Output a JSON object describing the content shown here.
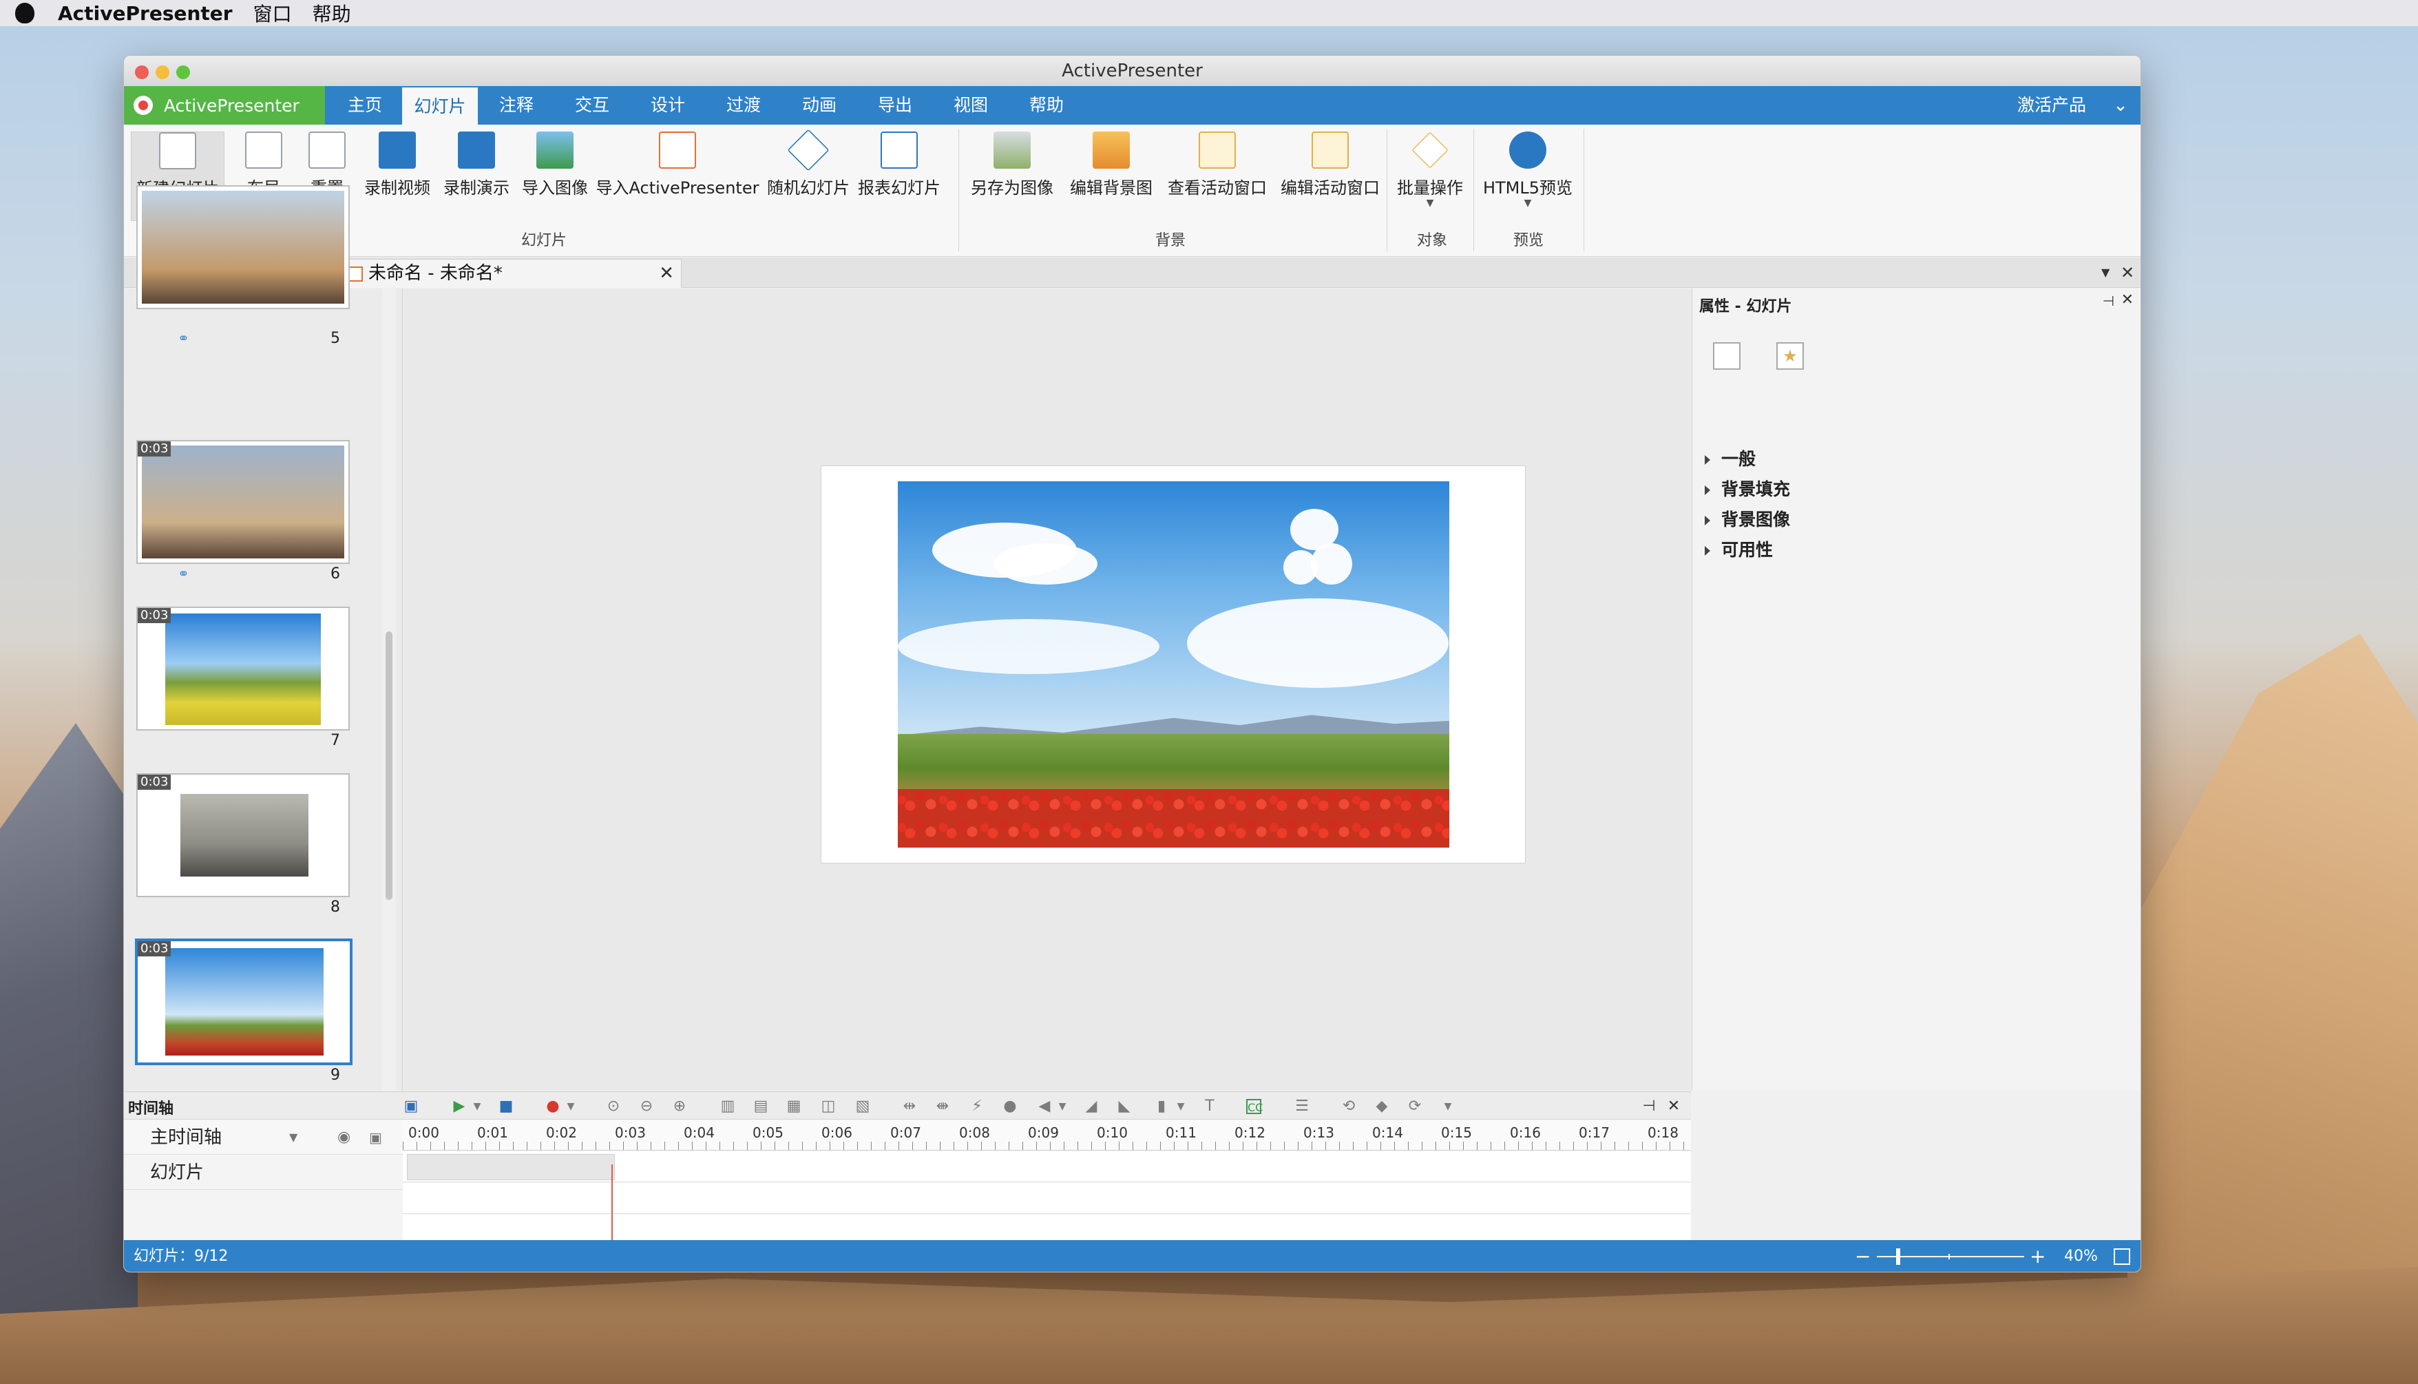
{
  "menubar": {
    "app": "ActivePresenter",
    "items": [
      "窗口",
      "帮助"
    ]
  },
  "window": {
    "title": "ActivePresenter"
  },
  "menu": {
    "app_tab": "ActivePresenter",
    "tabs": [
      "主页",
      "幻灯片",
      "注释",
      "交互",
      "设计",
      "过渡",
      "动画",
      "导出",
      "视图",
      "帮助"
    ],
    "active_tab": "幻灯片",
    "activate": "激活产品"
  },
  "ribbon": {
    "buttons": [
      "新建幻灯片",
      "布局",
      "重置",
      "录制视频",
      "录制演示",
      "导入图像",
      "导入ActivePresenter",
      "随机幻灯片",
      "报表幻灯片",
      "另存为图像",
      "编辑背景图",
      "查看活动窗口",
      "编辑活动窗口",
      "批量操作",
      "HTML5预览"
    ],
    "groups": [
      "幻灯片",
      "背景",
      "对象",
      "预览"
    ]
  },
  "document": {
    "tab_title": "未命名 - 未命名*"
  },
  "slides": [
    {
      "number": "5",
      "time": ""
    },
    {
      "number": "6",
      "time": "0:03"
    },
    {
      "number": "7",
      "time": "0:03"
    },
    {
      "number": "8",
      "time": "0:03"
    },
    {
      "number": "9",
      "time": "0:03"
    }
  ],
  "properties": {
    "title": "属性 - 幻灯片",
    "sections": [
      "一般",
      "背景填充",
      "背景图像",
      "可用性"
    ]
  },
  "timeline": {
    "title": "时间轴",
    "main": "主时间轴",
    "row": "幻灯片",
    "ticks": [
      "0:00",
      "0:01",
      "0:02",
      "0:03",
      "0:04",
      "0:05",
      "0:06",
      "0:07",
      "0:08",
      "0:09",
      "0:10",
      "0:11",
      "0:12",
      "0:13",
      "0:14",
      "0:15",
      "0:16",
      "0:17",
      "0:18"
    ]
  },
  "status": {
    "slide": "幻灯片：9/12",
    "zoom": "40%"
  },
  "colors": {
    "accent": "#2f82c8",
    "app_tab": "#55b646",
    "playhead": "#e05b4a"
  }
}
